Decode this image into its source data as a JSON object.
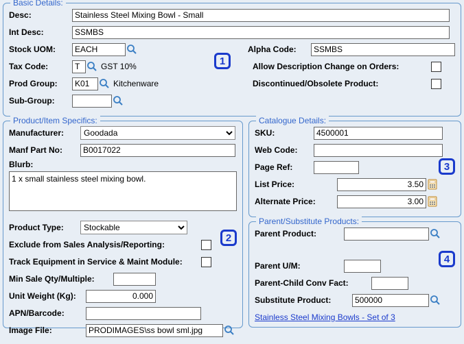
{
  "basic": {
    "legend": "Basic Details:",
    "desc_label": "Desc:",
    "desc": "Stainless Steel Mixing Bowl - Small",
    "intdesc_label": "Int Desc:",
    "intdesc": "SSMBS",
    "uom_label": "Stock UOM:",
    "uom": "EACH",
    "alphacode_label": "Alpha Code:",
    "alphacode": "SSMBS",
    "taxcode_label": "Tax Code:",
    "taxcode": "T",
    "taxcode_desc": "GST 10%",
    "allowdesc_label": "Allow Description Change on Orders:",
    "discontinued_label": "Discontinued/Obsolete Product:",
    "prodgroup_label": "Prod Group:",
    "prodgroup": "K01",
    "prodgroup_desc": "Kitchenware",
    "subgroup_label": "Sub-Group:",
    "subgroup": ""
  },
  "specifics": {
    "legend": "Product/Item Specifics:",
    "manufacturer_label": "Manufacturer:",
    "manufacturer": "Goodada",
    "partno_label": "Manf Part No:",
    "partno": "B0017022",
    "blurb_label": "Blurb:",
    "blurb": "1 x small stainless steel mixing bowl.",
    "prodtype_label": "Product Type:",
    "prodtype": "Stockable",
    "exclude_label": "Exclude from Sales Analysis/Reporting:",
    "track_label": "Track Equipment in Service & Maint Module:",
    "minsale_label": "Min Sale Qty/Multiple:",
    "minsale": "",
    "unitweight_label": "Unit Weight (Kg):",
    "unitweight": "0.000",
    "barcode_label": "APN/Barcode:",
    "barcode": "",
    "imagefile_label": "Image File:",
    "imagefile": "PRODIMAGES\\ss bowl sml.jpg"
  },
  "catalogue": {
    "legend": "Catalogue Details:",
    "sku_label": "SKU:",
    "sku": "4500001",
    "webcode_label": "Web Code:",
    "webcode": "",
    "pageref_label": "Page Ref:",
    "pageref": "",
    "listprice_label": "List Price:",
    "listprice": "3.50",
    "altprice_label": "Alternate Price:",
    "altprice": "3.00"
  },
  "parent": {
    "legend": "Parent/Substitute Products:",
    "parentprod_label": "Parent Product:",
    "parentprod": "",
    "parentum_label": "Parent U/M:",
    "parentum": "",
    "convfact_label": "Parent-Child Conv Fact:",
    "convfact": "",
    "substitute_label": "Substitute Product:",
    "substitute": "500000",
    "link_text": "Stainless Steel Mixing Bowls - Set of 3"
  },
  "callouts": {
    "c1": "1",
    "c2": "2",
    "c3": "3",
    "c4": "4"
  }
}
